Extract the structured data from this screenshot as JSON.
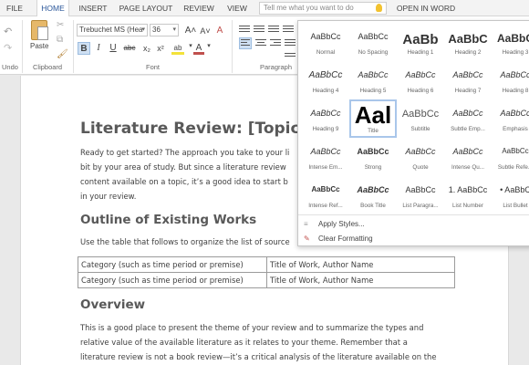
{
  "tabs": [
    "FILE",
    "HOME",
    "INSERT",
    "PAGE LAYOUT",
    "REVIEW",
    "VIEW"
  ],
  "active_tab": "HOME",
  "tell_me": {
    "placeholder": "Tell me what you want to do"
  },
  "open_in_word": "OPEN IN WORD",
  "ribbon": {
    "undo_label": "Undo",
    "clipboard_label": "Clipboard",
    "paste_label": "Paste",
    "font_label": "Font",
    "paragraph_label": "Paragraph",
    "font_name": "Trebuchet MS (Hea",
    "font_size": "36",
    "grow_font": "A˄",
    "shrink_font": "A˅",
    "clear_format": "A",
    "bold": "B",
    "italic": "I",
    "underline": "U",
    "strike": "abc",
    "subscript": "x₂",
    "superscript": "x²",
    "highlight": "ab",
    "font_color": "A"
  },
  "styles_gallery": {
    "styles": [
      {
        "preview": "AaBbCc",
        "name": "Normal"
      },
      {
        "preview": "AaBbCc",
        "name": "No Spacing"
      },
      {
        "preview": "AaBb",
        "name": "Heading 1"
      },
      {
        "preview": "AaBbC",
        "name": "Heading 2"
      },
      {
        "preview": "AaBbC",
        "name": "Heading 3"
      },
      {
        "preview": "AaBbCc",
        "name": "Heading 4"
      },
      {
        "preview": "AaBbCc",
        "name": "Heading 5"
      },
      {
        "preview": "AaBbCc",
        "name": "Heading 6"
      },
      {
        "preview": "AaBbCc",
        "name": "Heading 7"
      },
      {
        "preview": "AaBbCc",
        "name": "Heading 8"
      },
      {
        "preview": "AaBbCc",
        "name": "Heading 9"
      },
      {
        "preview": "Aal",
        "name": "Title"
      },
      {
        "preview": "AaBbCc",
        "name": "Subtitle"
      },
      {
        "preview": "AaBbCc",
        "name": "Subtle Emp..."
      },
      {
        "preview": "AaBbCc",
        "name": "Emphasis"
      },
      {
        "preview": "AaBbCc",
        "name": "Intense Em..."
      },
      {
        "preview": "AaBbCc",
        "name": "Strong"
      },
      {
        "preview": "AaBbCc",
        "name": "Quote"
      },
      {
        "preview": "AaBbCc",
        "name": "Intense Qu..."
      },
      {
        "preview": "AaBbCc",
        "name": "Subtle Refe..."
      },
      {
        "preview": "AaBbCc",
        "name": "Intense Ref..."
      },
      {
        "preview": "AaBbCc",
        "name": "Book Title"
      },
      {
        "preview": "AaBbCc",
        "name": "List Paragra..."
      },
      {
        "preview": "1. AaBbCc",
        "name": "List Number"
      },
      {
        "preview": "• AaBbC",
        "name": "List Bullet"
      }
    ],
    "apply_styles": "Apply Styles...",
    "clear_formatting": "Clear Formatting"
  },
  "document": {
    "title": "Literature Review: [Topic]",
    "intro_lines": [
      "Ready to get started? The approach you take to your li",
      "bit by your area of study. But since a literature review",
      "content available on a topic, it’s a good idea to start b",
      "in your review."
    ],
    "outline_heading": "Outline of Existing Works",
    "outline_text": "Use the table that follows to organize the list of source",
    "table_rows": [
      [
        "Category (such as time period or premise)",
        "Title of Work, Author Name"
      ],
      [
        "Category (such as time period or premise)",
        "Title of Work, Author Name"
      ]
    ],
    "overview_heading": "Overview",
    "overview_lines": [
      "This is a good place to present the theme of your review and to summarize the types and",
      "relative value of the available literature as it relates to your theme. Remember that a",
      "literature review is not a book review—it’s a critical analysis of the literature available on the"
    ]
  },
  "colors": {
    "accent": "#2b579a",
    "heading": "#595959",
    "highlight": "#f3e23a",
    "font_color": "#c0504d"
  }
}
